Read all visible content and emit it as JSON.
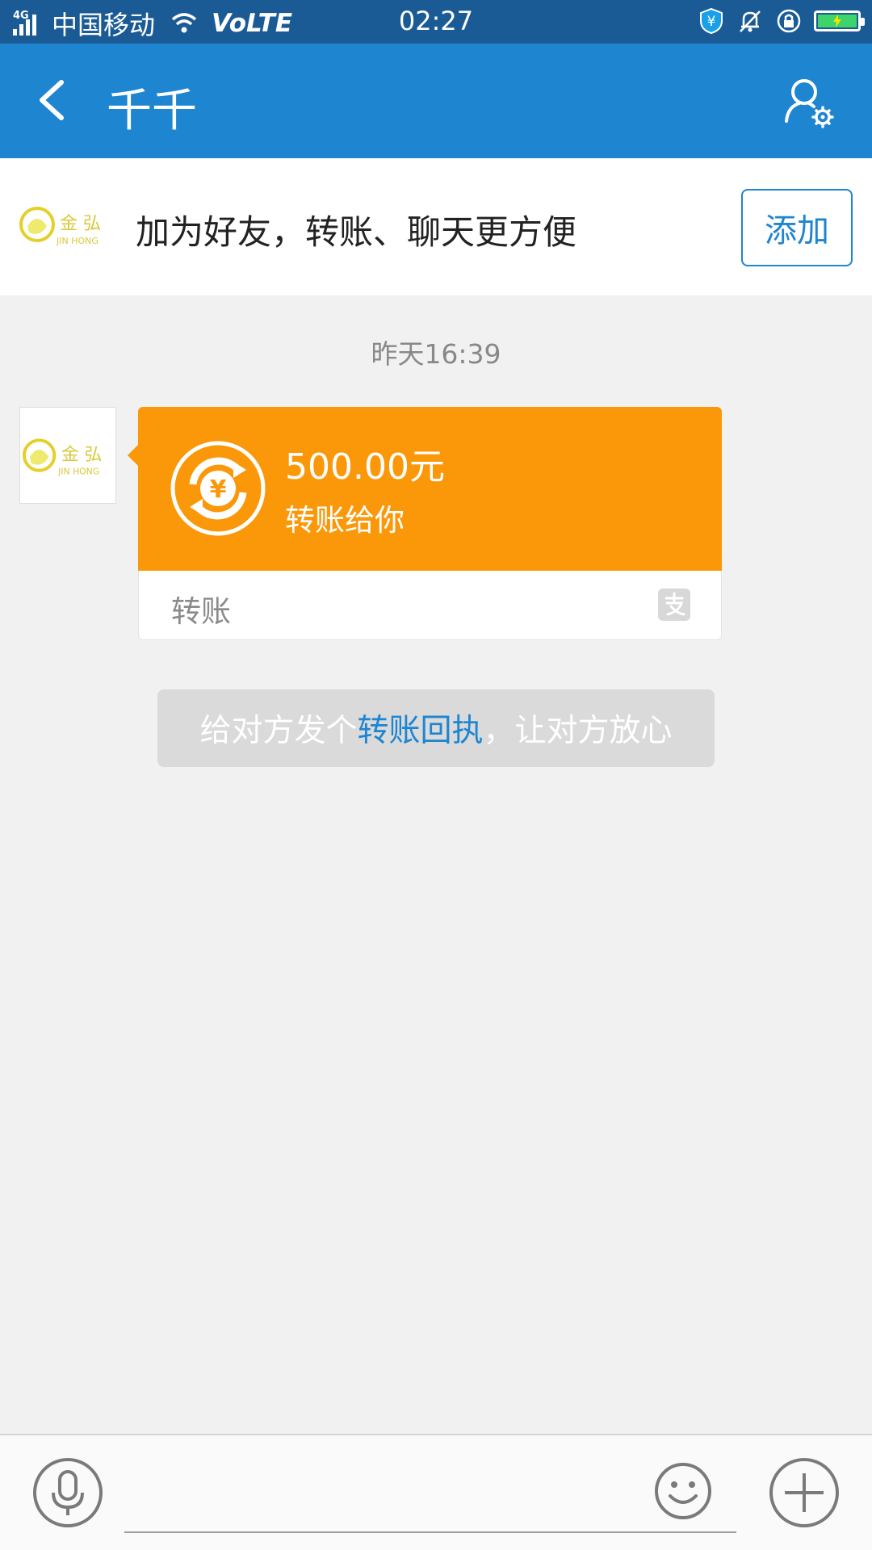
{
  "status_bar": {
    "network_type": "4G",
    "carrier": "中国移动",
    "volte": "VoLTE",
    "time": "02:27",
    "icons": [
      "signal-icon",
      "wifi-icon",
      "payment-shield-icon",
      "mute-bell-icon",
      "rotation-lock-icon",
      "battery-charging-icon"
    ]
  },
  "header": {
    "title": "千千",
    "back_icon": "chevron-left-icon",
    "profile_icon": "profile-settings-icon"
  },
  "banner": {
    "logo_text_cn": "金 弘",
    "logo_text_en": "JIN HONG",
    "message": "加为好友，转账、聊天更方便",
    "add_label": "添加"
  },
  "chat": {
    "timestamp": "昨天16:39",
    "avatar_text_cn": "金 弘",
    "avatar_text_en": "JIN HONG",
    "transfer": {
      "amount": "500.00元",
      "description": "转账给你",
      "footer_label": "转账",
      "footer_icon": "alipay-icon"
    },
    "tip": {
      "prefix": "给对方发个",
      "link": "转账回执",
      "suffix": "，让对方放心"
    }
  },
  "input_bar": {
    "value": "",
    "icons": [
      "microphone-icon",
      "emoji-icon",
      "plus-icon"
    ]
  },
  "colors": {
    "status_bar": "#1a5b96",
    "app_bar": "#1e85d1",
    "transfer_orange": "#fb980a",
    "accent_blue": "#1e85d1",
    "chat_background": "#f1f1f1"
  }
}
